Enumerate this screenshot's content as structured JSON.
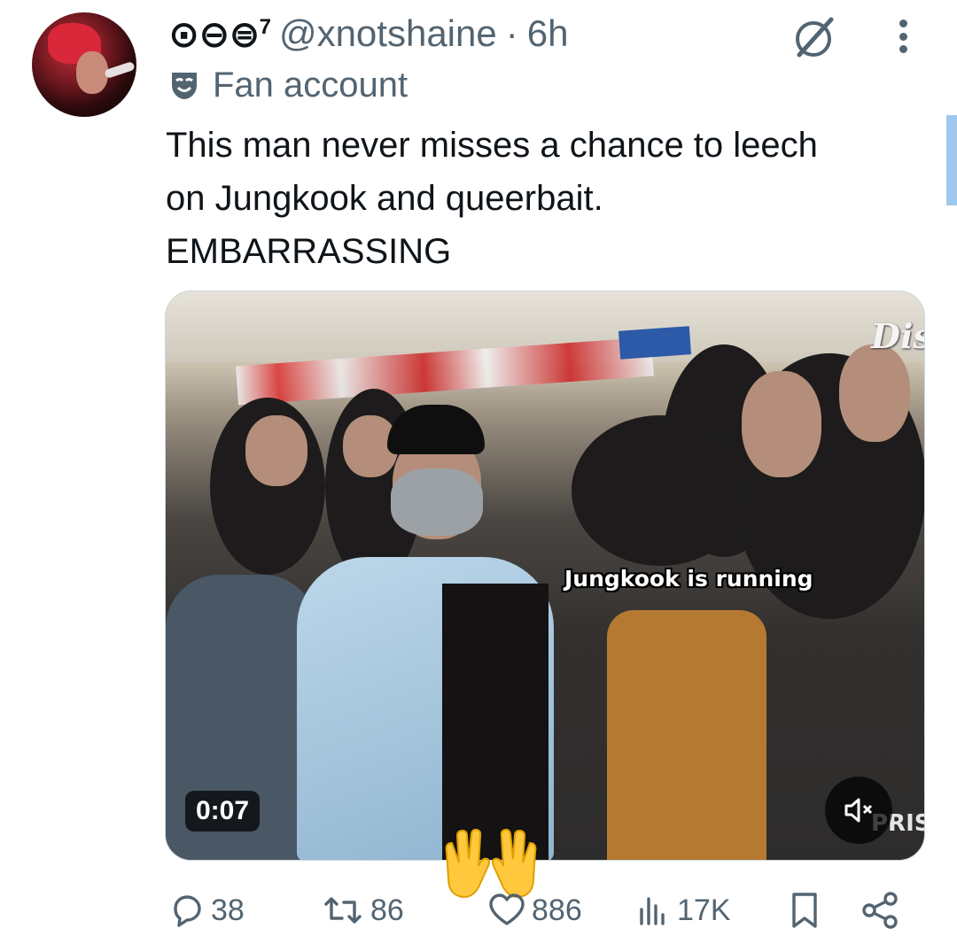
{
  "author": {
    "display_name": "⊙⊖⊜",
    "name_suffix": "7",
    "handle": "@xnotshaine",
    "separator": "·",
    "time": "6h",
    "label": "Fan account"
  },
  "tweet": {
    "text": "This man never misses a chance to leech\non Jungkook and queerbait.\nEMBARRASSING"
  },
  "media": {
    "caption": "Jungkook is running",
    "watermark_top": "Dis",
    "watermark_bottom": "PRIS",
    "duration": "0:07",
    "hands_emoji": "🙌"
  },
  "actions": {
    "replies": "38",
    "retweets": "86",
    "likes": "886",
    "views": "17K"
  },
  "icons": {
    "reply": "reply-icon",
    "retweet": "retweet-icon",
    "like": "heart-icon",
    "views": "views-icon",
    "bookmark": "bookmark-icon",
    "share": "share-icon",
    "grok": "grok-icon",
    "more": "more-icon",
    "mute": "mute-icon",
    "label": "mask-icon"
  },
  "colors": {
    "text_primary": "#0f1419",
    "text_secondary": "#536471",
    "scroll_accent": "#9fc9ec"
  }
}
